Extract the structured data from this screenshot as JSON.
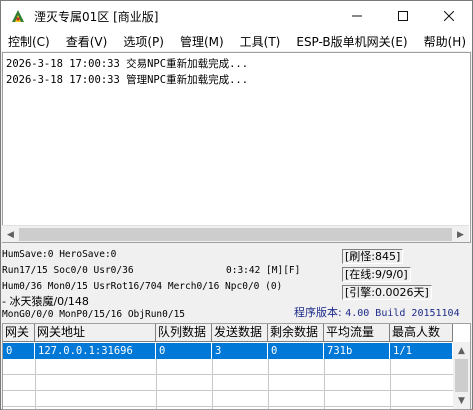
{
  "window": {
    "title": "湮灭专属01区 [商业版]"
  },
  "menu": [
    {
      "label": "控制(C)"
    },
    {
      "label": "查看(V)"
    },
    {
      "label": "选项(P)"
    },
    {
      "label": "管理(M)"
    },
    {
      "label": "工具(T)"
    },
    {
      "label": "ESP-B版单机网关(E)"
    },
    {
      "label": "帮助(H)"
    }
  ],
  "log": [
    "2026-3-18 17:00:33 交易NPC重新加载完成...",
    "2026-3-18 17:00:33 管理NPC重新加载完成..."
  ],
  "status": {
    "line1": "HumSave:0 HeroSave:0",
    "line2": "Run17/15 Soc0/0 Usr0/36",
    "clock": "0:3:42 [M][F]",
    "line3": "Hum0/36 Mon0/15 UsrRot16/704 Merch0/16 Npc0/0 (0)",
    "line4": " - 冰天猿魔/0/148",
    "line5": "MonG0/0/0 MonP0/15/16 ObjRun0/15",
    "refresh": "[刷怪:845]",
    "online": "[在线:9/9/0]",
    "engine": "[引擎:0.0026天]",
    "version_label": "程序版本: ",
    "version_value": "4.00 Build 20151104"
  },
  "grid": {
    "headers": [
      "网关",
      "网关地址",
      "队列数据",
      "发送数据",
      "剩余数据",
      "平均流量",
      "最高人数"
    ],
    "rows": [
      [
        "0",
        "127.0.0.1:31696",
        "0",
        "3",
        "0",
        "731b",
        "1/1"
      ]
    ]
  },
  "colors": {
    "selection": "#0078d7",
    "version_text": "#1d2b8a"
  }
}
